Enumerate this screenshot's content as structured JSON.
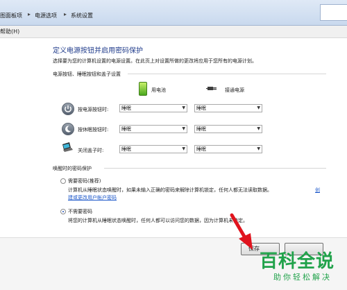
{
  "breadcrumb": {
    "item1": "图面板项",
    "item2": "电源选项",
    "item3": "系统设置",
    "separator": "▸"
  },
  "menu": {
    "help": "帮助(H)"
  },
  "page": {
    "title": "定义电源按钮并启用密码保护",
    "intro": "选择要为您的计算机设置的电源设置。在此页上对设置所做的更改将应用于您所有的电源计划。"
  },
  "power_section": {
    "heading": "电源按钮、睡眠按钮和盖子设置",
    "col_battery": "用电池",
    "col_plugged": "接通电源",
    "rows": [
      {
        "label": "按电源按钮时:",
        "battery": "睡眠",
        "plugged": "睡眠"
      },
      {
        "label": "按休眠按钮时:",
        "battery": "睡眠",
        "plugged": "睡眠"
      },
      {
        "label": "关闭盖子时:",
        "battery": "睡眠",
        "plugged": "睡眠"
      }
    ]
  },
  "password_section": {
    "heading": "唤醒时的密码保护",
    "option_require": "需要密码(推荐)",
    "desc_require": "计算机从睡眠状态唤醒时，如果未输入正确的密码来解除计算机锁定，任何人都无法读取数据。",
    "link_part1": "创",
    "link_part2": "建或更改用户帐户密码",
    "option_none": "不需要密码",
    "desc_none": "将您的计算机从睡眠状态唤醒时，任何人都可以访问您的数据，因为计算机未锁定。",
    "selected": "不需要密码"
  },
  "footer": {
    "save": "保存"
  },
  "watermark": {
    "main": "百科全说",
    "sub": "助你轻松解决"
  },
  "colors": {
    "title_blue": "#1e3a8a",
    "link_blue": "#1a56c9",
    "arrow_red": "#e0141e",
    "watermark_green": "#20a24a"
  }
}
